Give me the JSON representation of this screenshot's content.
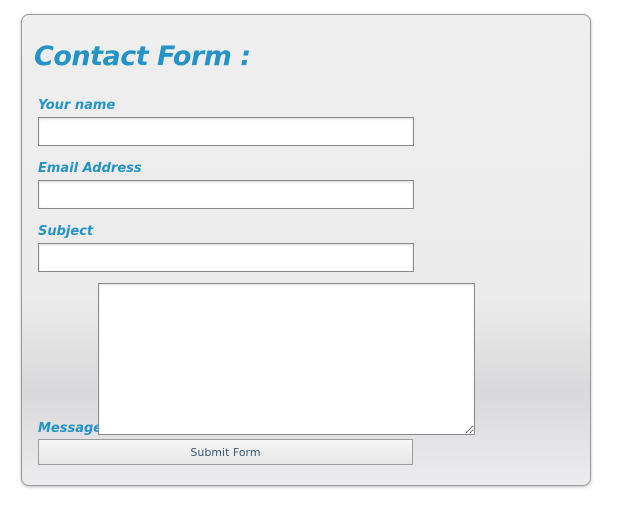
{
  "form": {
    "title": "Contact Form :",
    "fields": {
      "name": {
        "label": "Your name",
        "value": ""
      },
      "email": {
        "label": "Email Address",
        "value": ""
      },
      "subject": {
        "label": "Subject",
        "value": ""
      },
      "message": {
        "label": "Message",
        "value": ""
      }
    },
    "submit_label": "Submit Form"
  },
  "colors": {
    "accent": "#2493c7",
    "panel_background": "#ececec",
    "panel_border": "#9a9a9a",
    "button_text": "#3a5a7a"
  }
}
